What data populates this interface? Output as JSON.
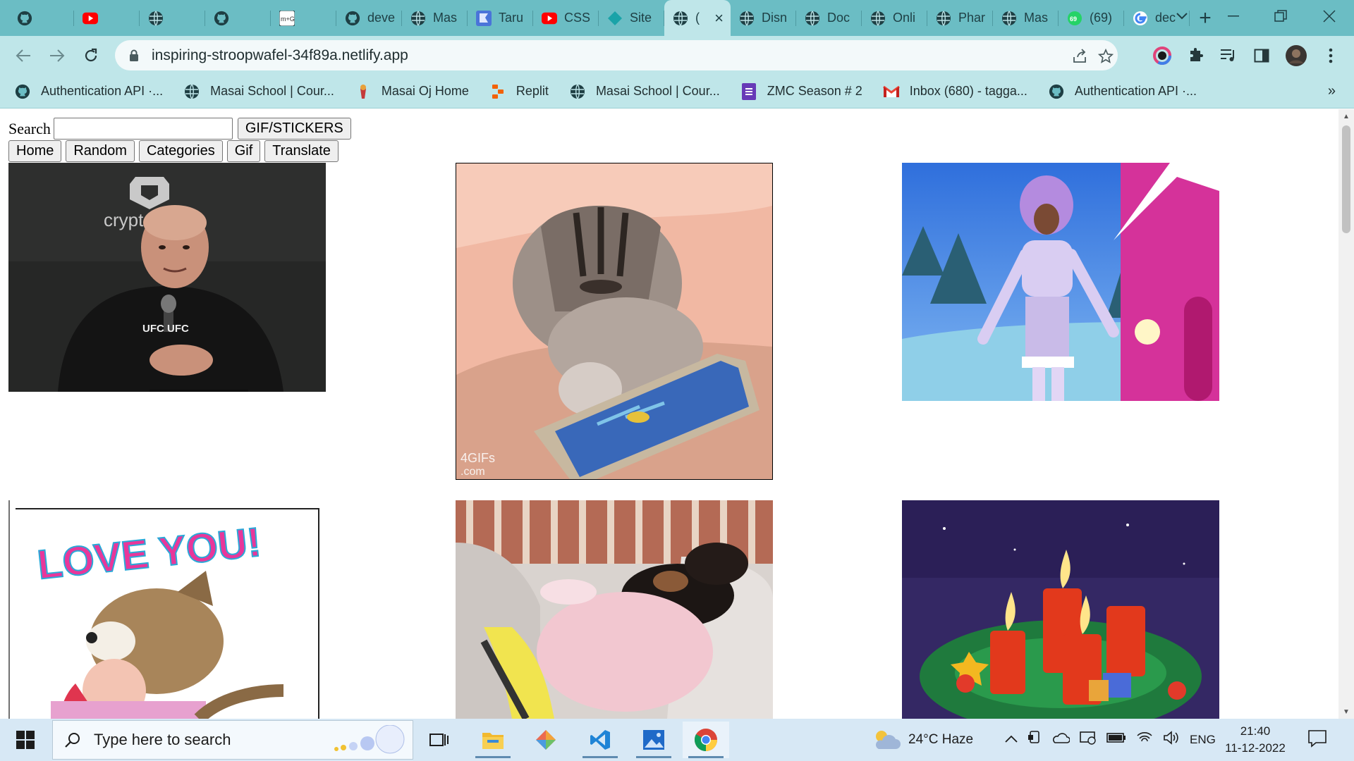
{
  "browser": {
    "tabs": [
      {
        "title": "",
        "icon": "github-icon"
      },
      {
        "title": "",
        "icon": "youtube-icon"
      },
      {
        "title": "",
        "icon": "globe-icon"
      },
      {
        "title": "",
        "icon": "github-icon"
      },
      {
        "title": "",
        "icon": "m-g-icon"
      },
      {
        "title": "deve",
        "icon": "github-icon"
      },
      {
        "title": "Mas",
        "icon": "globe-icon"
      },
      {
        "title": "Taru",
        "icon": "bookmark-flag-icon"
      },
      {
        "title": "CSS",
        "icon": "youtube-icon"
      },
      {
        "title": "Site",
        "icon": "netlify-icon"
      },
      {
        "title": "(",
        "icon": "globe-icon",
        "active": true
      },
      {
        "title": "Disn",
        "icon": "globe-icon"
      },
      {
        "title": "Doc",
        "icon": "globe-icon"
      },
      {
        "title": "Onli",
        "icon": "globe-icon"
      },
      {
        "title": "Phar",
        "icon": "globe-icon"
      },
      {
        "title": "Mas",
        "icon": "globe-icon"
      },
      {
        "title": "(69)",
        "icon": "whatsapp-icon"
      },
      {
        "title": "dec",
        "icon": "google-icon"
      }
    ],
    "url": "inspiring-stroopwafel-34f89a.netlify.app",
    "bookmarks": [
      {
        "label": "Authentication API ·...",
        "icon": "github-icon"
      },
      {
        "label": "Masai School | Cour...",
        "icon": "globe-icon"
      },
      {
        "label": "Masai Oj Home",
        "icon": "masai-icon"
      },
      {
        "label": "Replit",
        "icon": "replit-icon"
      },
      {
        "label": "Masai School | Cour...",
        "icon": "globe-icon"
      },
      {
        "label": "ZMC Season # 2",
        "icon": "forms-icon"
      },
      {
        "label": "Inbox (680) - tagga...",
        "icon": "gmail-icon"
      },
      {
        "label": "Authentication API ·...",
        "icon": "github-icon"
      }
    ]
  },
  "app": {
    "search_label": "Search",
    "search_value": "",
    "search_button": "GIF/STICKERS",
    "nav": [
      "Home",
      "Random",
      "Categories",
      "Gif",
      "Translate"
    ],
    "tiles": [
      {
        "name": "gif-press-conference",
        "overlay_text": "crypt   m",
        "caption": "UFC UFC"
      },
      {
        "name": "gif-kitten-tablet",
        "watermark": "4GIFs\n.com"
      },
      {
        "name": "gif-winter-doll"
      },
      {
        "name": "sticker-love-you",
        "overlay_text": "LOVE YOU!"
      },
      {
        "name": "gif-dog-on-couch"
      },
      {
        "name": "gif-advent-candles"
      }
    ]
  },
  "taskbar": {
    "search_placeholder": "Type here to search",
    "weather": "24°C  Haze",
    "language": "ENG",
    "time": "21:40",
    "date": "11-12-2022"
  },
  "colors": {
    "tabstrip": "#6bbdc4",
    "toolbar": "#bfe6e9",
    "taskbar": "#d7e8f5"
  }
}
